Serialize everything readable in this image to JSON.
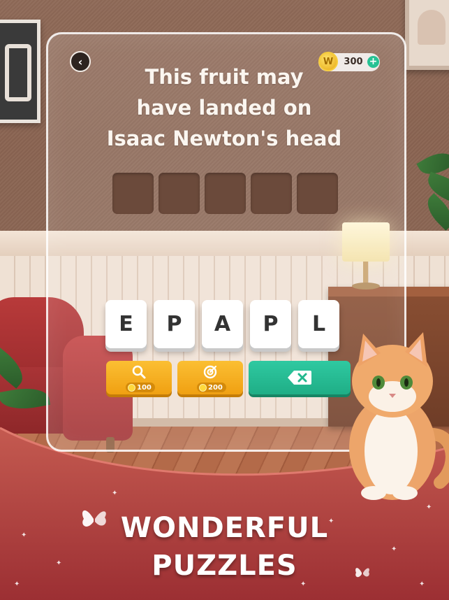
{
  "game": {
    "question_lines": [
      "This fruit may",
      "have landed on",
      "Isaac Newton's head"
    ],
    "answer_slot_count": 5,
    "coins": "300",
    "coin_icon_letter": "W",
    "letter_tiles": [
      "E",
      "P",
      "A",
      "P",
      "L"
    ],
    "hint_magnify_cost": "100",
    "hint_target_cost": "200",
    "icons": {
      "back": "chevron-left-icon",
      "coin": "coin-icon",
      "add": "plus-icon",
      "magnify": "magnifier-icon",
      "target": "target-icon",
      "delete": "backspace-icon"
    }
  },
  "promo": {
    "headline_line1": "WONDERFUL",
    "headline_line2": "PUZZLES"
  },
  "colors": {
    "hint_button": "#f6aa1c",
    "delete_button": "#22b88e",
    "coin_plus": "#27c294",
    "banner": "#b94b47"
  }
}
